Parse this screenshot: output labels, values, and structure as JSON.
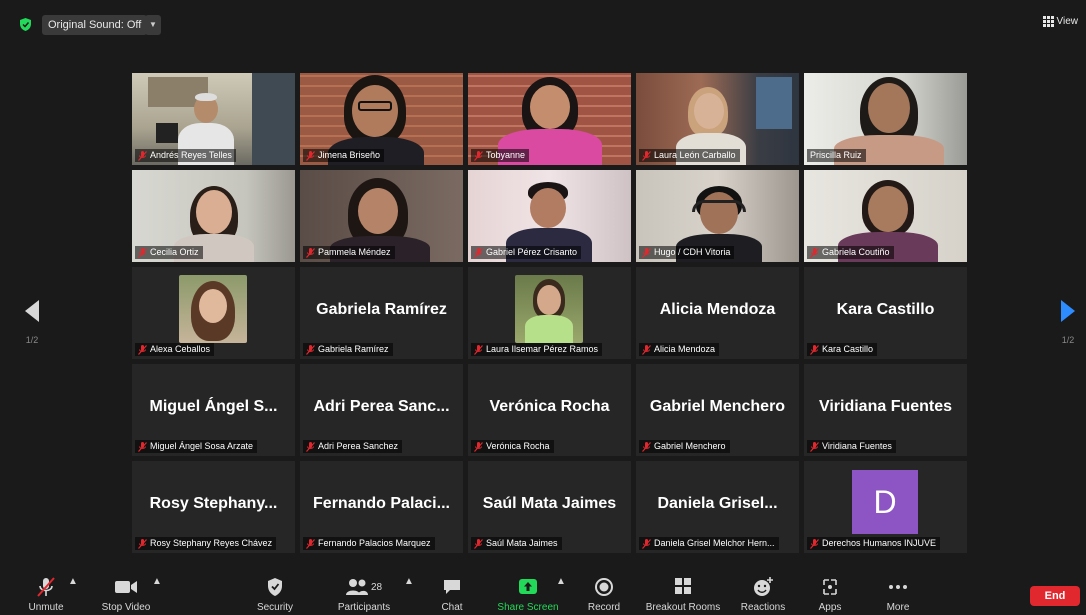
{
  "top_bar": {
    "original_sound": "Original Sound: Off",
    "view_label": "View"
  },
  "pager": {
    "left_page": "1/2",
    "right_page": "1/2"
  },
  "tiles": [
    {
      "name": "Andrés Reyes Telles",
      "type": "video"
    },
    {
      "name": "Jimena Briseño",
      "type": "video"
    },
    {
      "name": "Tobyanne",
      "type": "video"
    },
    {
      "name": "Laura León Carballo",
      "type": "video"
    },
    {
      "name": "Priscilla Ruiz",
      "type": "video",
      "active_speaker": true
    },
    {
      "name": "Cecilia Ortiz",
      "type": "video"
    },
    {
      "name": "Pammela Méndez",
      "type": "video"
    },
    {
      "name": "Gabriel Pérez Crisanto",
      "type": "video"
    },
    {
      "name": "Hugo / CDH Vitoria",
      "type": "video"
    },
    {
      "name": "Gabriela Coutiño",
      "type": "video"
    },
    {
      "name": "Alexa Ceballos",
      "type": "photo"
    },
    {
      "name": "Gabriela Ramírez",
      "type": "name",
      "display": "Gabriela Ramírez"
    },
    {
      "name": "Laura Ilsemar Pérez Ramos",
      "type": "photo"
    },
    {
      "name": "Alicia Mendoza",
      "type": "name",
      "display": "Alicia Mendoza"
    },
    {
      "name": "Kara Castillo",
      "type": "name",
      "display": "Kara Castillo"
    },
    {
      "name": "Miguel Ángel Sosa Arzate",
      "type": "name",
      "display": "Miguel Ángel S..."
    },
    {
      "name": "Adri Perea Sanchez",
      "type": "name",
      "display": "Adri Perea Sanc..."
    },
    {
      "name": "Verónica Rocha",
      "type": "name",
      "display": "Verónica Rocha"
    },
    {
      "name": "Gabriel Menchero",
      "type": "name",
      "display": "Gabriel Menchero"
    },
    {
      "name": "Viridiana Fuentes",
      "type": "name",
      "display": "Viridiana Fuentes"
    },
    {
      "name": "Rosy Stephany Reyes Chávez",
      "type": "name",
      "display": "Rosy Stephany..."
    },
    {
      "name": "Fernando Palacios Marquez",
      "type": "name",
      "display": "Fernando Palaci..."
    },
    {
      "name": "Saúl Mata Jaimes",
      "type": "name",
      "display": "Saúl Mata Jaimes"
    },
    {
      "name": "Daniela Grisel Melchor Hern...",
      "type": "name",
      "display": "Daniela Grisel..."
    },
    {
      "name": "Derechos Humanos INJUVE",
      "type": "avatar",
      "initial": "D"
    }
  ],
  "toolbar": {
    "unmute": "Unmute",
    "stop_video": "Stop Video",
    "security": "Security",
    "participants": "Participants",
    "participants_count": "28",
    "chat": "Chat",
    "share_screen": "Share Screen",
    "record": "Record",
    "breakout_rooms": "Breakout Rooms",
    "reactions": "Reactions",
    "apps": "Apps",
    "more": "More",
    "end": "End"
  },
  "colors": {
    "background": "#1a1a1a",
    "tile_background": "#262626",
    "active_speaker_border": "#d6e56a",
    "muted_mic": "#e0282e",
    "share_screen": "#23d959",
    "end_button": "#e0282e",
    "avatar": "#8d55c4",
    "pager_arrow_right": "#2d8cff",
    "shield": "#23d959"
  },
  "icons": [
    "shield-icon",
    "grid-icon",
    "muted-mic-icon",
    "video-camera-icon",
    "security-shield-icon",
    "participants-icon",
    "chat-bubble-icon",
    "share-screen-arrow-icon",
    "record-icon",
    "breakout-rooms-icon",
    "reactions-icon",
    "apps-icon",
    "more-dots-icon",
    "chevron-up-icon",
    "arrow-left-icon",
    "arrow-right-icon"
  ]
}
